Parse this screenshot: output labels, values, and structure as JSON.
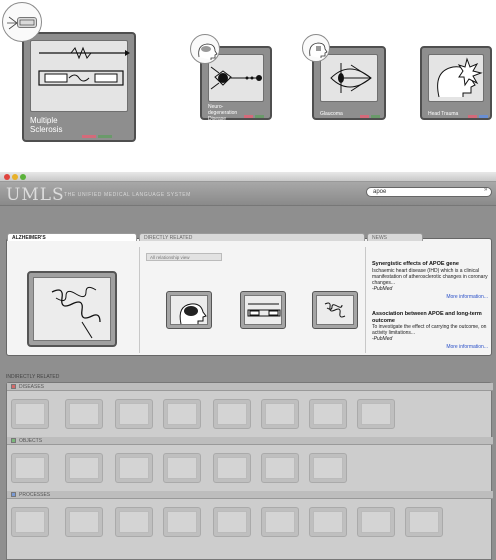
{
  "cards": [
    {
      "label_line1": "Multiple",
      "label_line2": "Sclerosis",
      "swatches": [
        "#d46a7a",
        "#6a9a6a"
      ]
    },
    {
      "label_line1": "Neuro-",
      "label_line2": "degeneration",
      "label_line3": "Disease",
      "swatches": [
        "#d46a7a",
        "#6a9a6a"
      ]
    },
    {
      "label_line1": "Glaucoma",
      "swatches": [
        "#d46a7a",
        "#6a9a6a"
      ]
    },
    {
      "label_line1": "Head Trauma",
      "swatches": [
        "#d46a7a",
        "#6a8fd4"
      ]
    }
  ],
  "window": {
    "logo": "UMLS",
    "subtitle": "THE UNIFIED MEDICAL LANGUAGE SYSTEM",
    "search_value": "apoe",
    "search_go": "»"
  },
  "main": {
    "tab_title": "ALZHEIMER'S",
    "tab_direct": "DIRECTLY RELATED",
    "tab_news": "NEWS",
    "relationship_label": "All relationship view"
  },
  "news": [
    {
      "title": "Synergistic effects of APOE gene",
      "body": "Ischaemic heart disease (IHD) which is a clinical manifestation of atherosclerotic changes in coronary changes...",
      "source": "-PubMed",
      "more": "More information..."
    },
    {
      "title": "Association between APOE and long-term outcome",
      "body": "To investigate the effect of carrying the outcome, on activity limitations...",
      "source": "-PubMed",
      "more": "More information..."
    }
  ],
  "indirect": {
    "title": "INDIRECTLY RELATED",
    "sections": [
      "DISEASES",
      "OBJECTS",
      "PROCESSES"
    ],
    "section_colors": [
      "#d46a6a",
      "#7ab87a",
      "#7a9ad4"
    ]
  },
  "colors": {
    "window_bg": "#8f8f8f",
    "panel_bg": "#f4f4f4",
    "link": "#2b51c8"
  }
}
